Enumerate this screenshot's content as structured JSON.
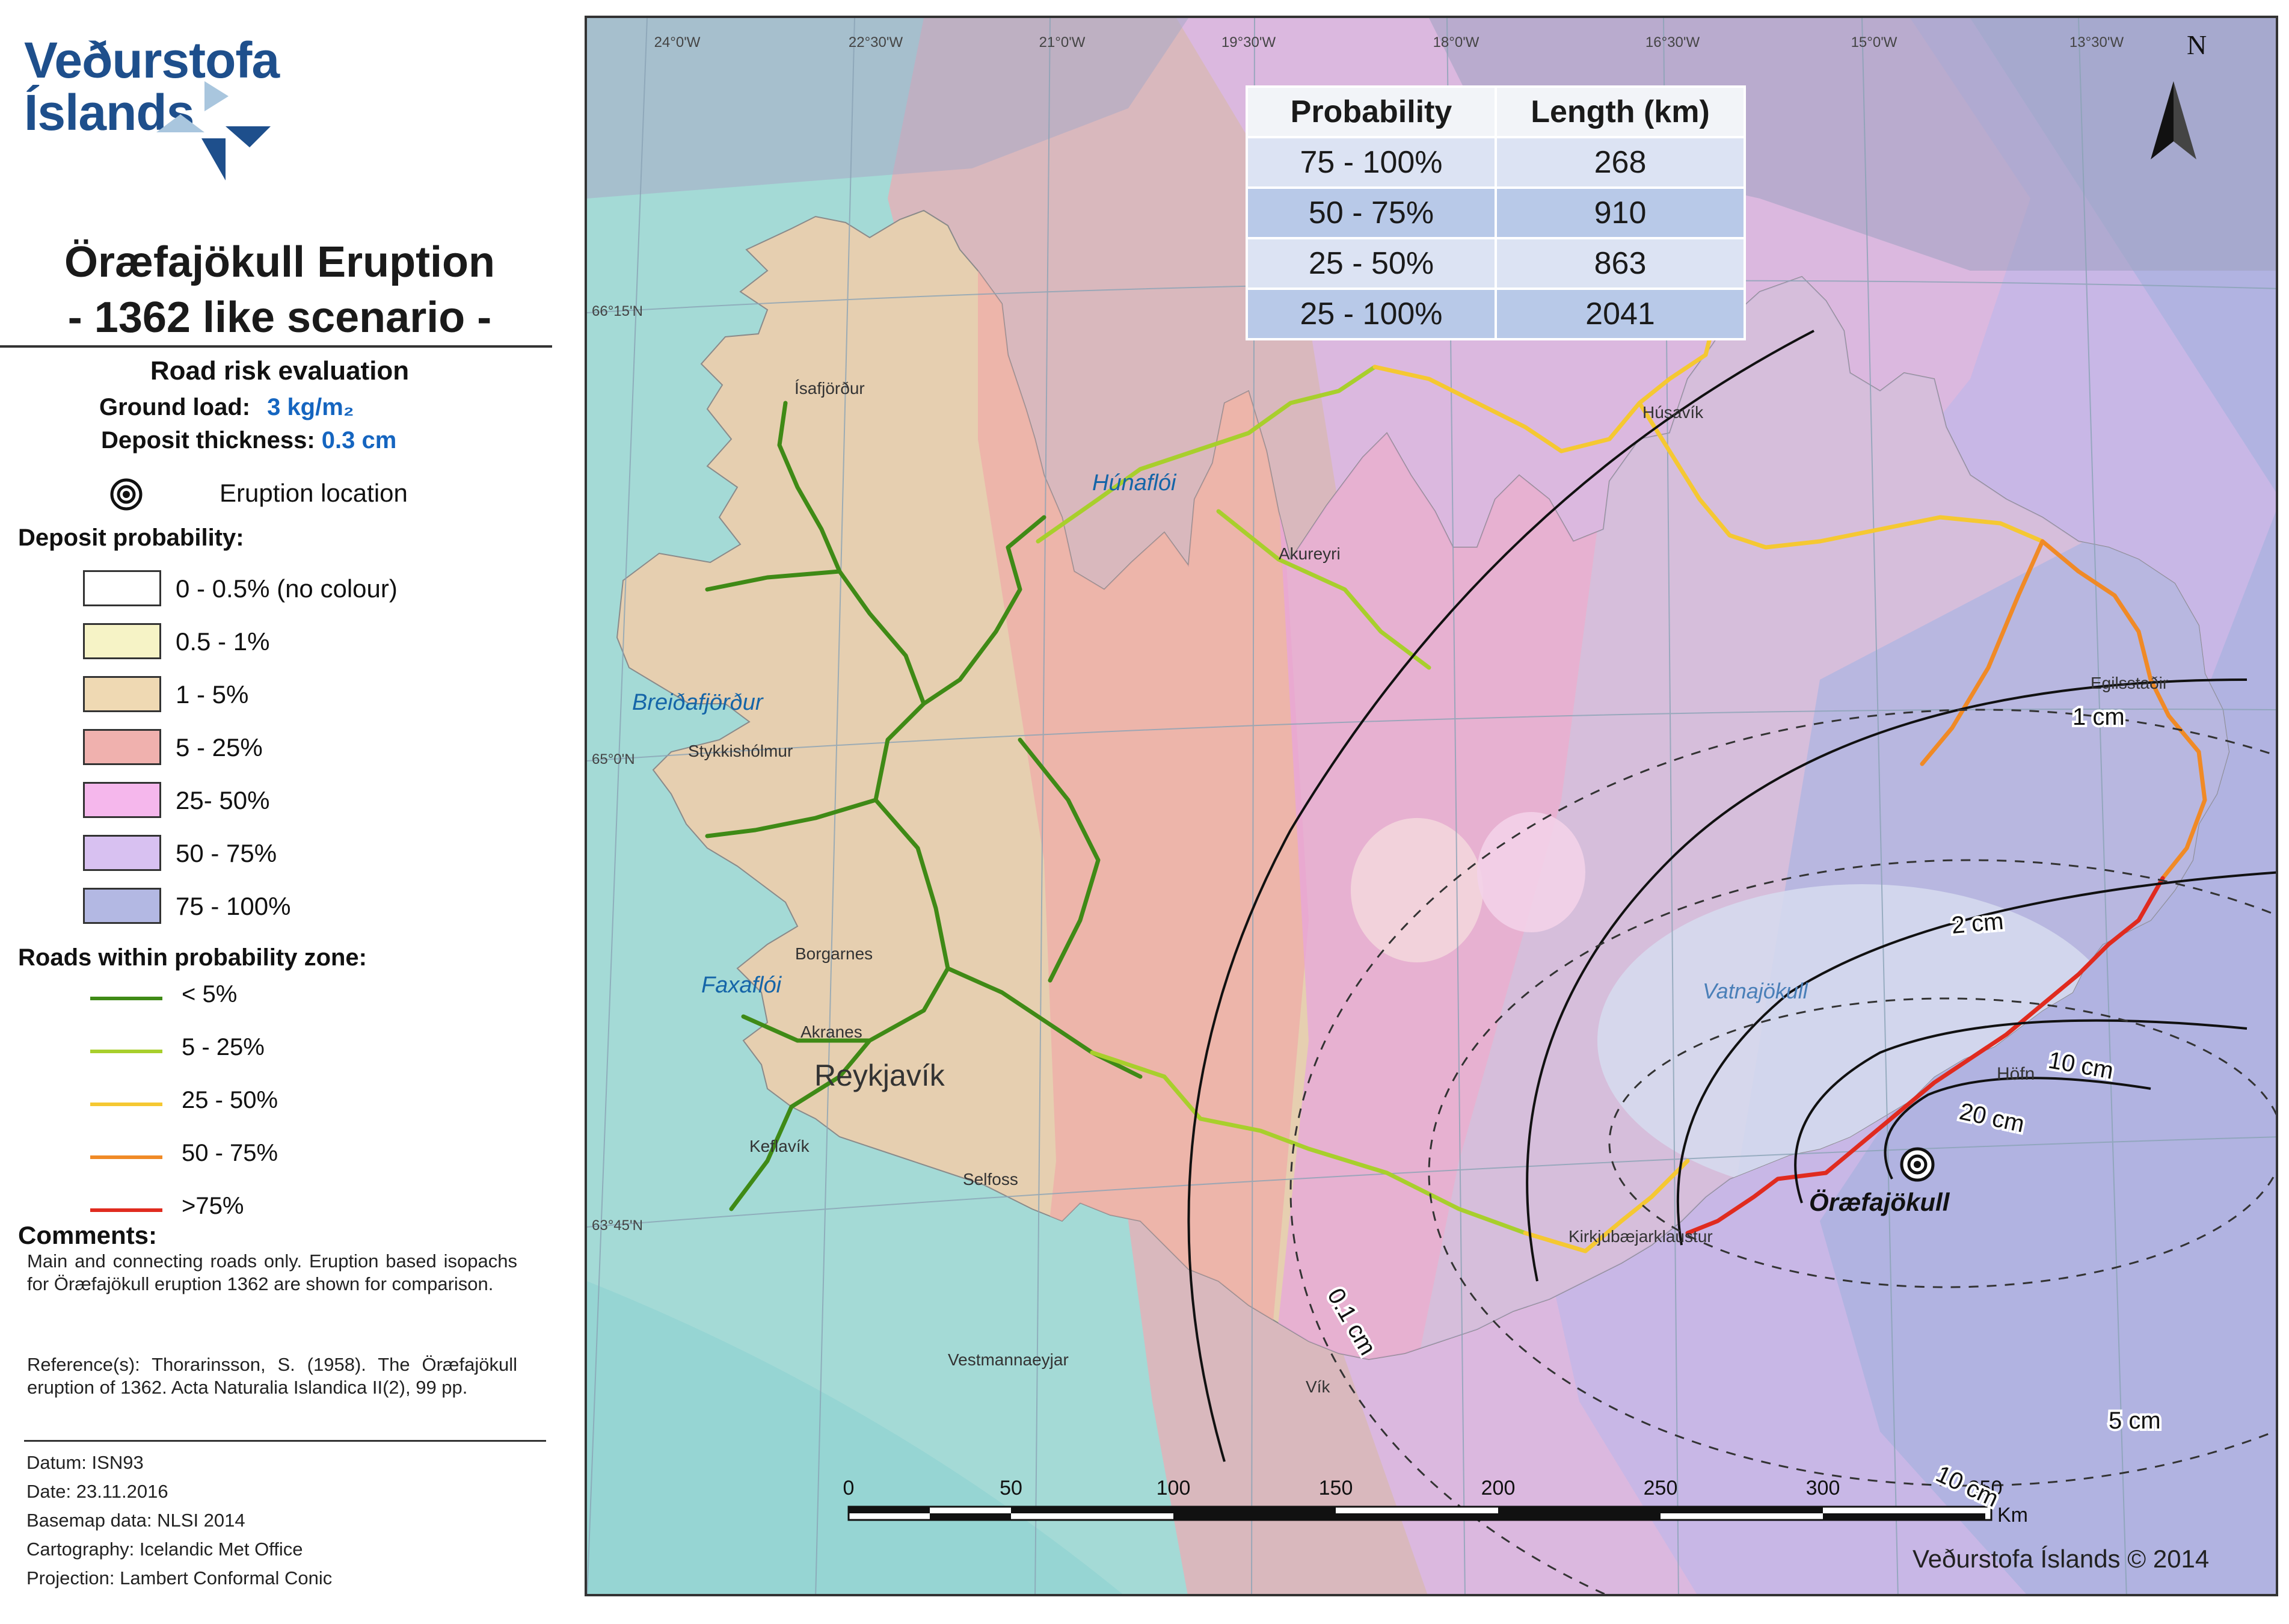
{
  "organization": {
    "line1": "Veðurstofa",
    "line2": "Íslands"
  },
  "title": {
    "line1": "Öræfajökull Eruption",
    "line2": "- 1362 like scenario -"
  },
  "legend": {
    "heading": "Road risk evaluation",
    "ground_load_label": "Ground load:",
    "ground_load_value": "3 kg/m₂",
    "deposit_thickness_label": "Deposit thickness:",
    "deposit_thickness_value": "0.3 cm",
    "eruption_location_label": "Eruption location",
    "deposit_probability_heading": "Deposit probability:",
    "deposit_classes": [
      {
        "label": "0 - 0.5% (no colour)",
        "color": "#ffffff"
      },
      {
        "label": "0.5 - 1%",
        "color": "#f6f3c6"
      },
      {
        "label": "1 - 5%",
        "color": "#efd9b3"
      },
      {
        "label": "5 - 25%",
        "color": "#f0b1ae"
      },
      {
        "label": "25- 50%",
        "color": "#f5b7ec"
      },
      {
        "label": "50 - 75%",
        "color": "#d8c1f1"
      },
      {
        "label": "75 - 100%",
        "color": "#b3b8e3"
      }
    ],
    "roads_heading": "Roads within probability zone:",
    "road_classes": [
      {
        "label": "< 5%",
        "color": "#3f8a16"
      },
      {
        "label": "5 - 25%",
        "color": "#a8cf2c"
      },
      {
        "label": "25 - 50%",
        "color": "#f5c832"
      },
      {
        "label": "50 - 75%",
        "color": "#f08a26"
      },
      {
        "label": ">75%",
        "color": "#e02b1f"
      }
    ]
  },
  "comments": {
    "heading": "Comments:",
    "text": "Main and connecting roads only. Eruption based isopachs for Öræfajökull eruption 1362 are shown for comparison.",
    "reference": "Reference(s): Thorarinsson, S. (1958). The Öræfajökull eruption of 1362. Acta Naturalia Islandica II(2), 99 pp."
  },
  "metadata": {
    "datum": "Datum: ISN93",
    "date": "Date: 23.11.2016",
    "basemap": "Basemap data: NLSI 2014",
    "cartography": "Cartography: Icelandic Met Office",
    "projection": "Projection: Lambert Conformal Conic"
  },
  "table": {
    "headers": [
      "Probability",
      "Length (km)"
    ],
    "rows": [
      [
        "75 - 100%",
        "268"
      ],
      [
        "50 - 75%",
        "910"
      ],
      [
        "25 - 50%",
        "863"
      ],
      [
        "25 - 100%",
        "2041"
      ]
    ]
  },
  "map": {
    "graticule_labels": {
      "longitudes": [
        "24°0'W",
        "22°30'W",
        "21°0'W",
        "19°30'W",
        "18°0'W",
        "16°30'W",
        "15°0'W",
        "13°30'W"
      ],
      "latitudes": [
        "66°15'N",
        "65°0'N",
        "63°45'N"
      ]
    },
    "north_label": "N",
    "place_names": [
      {
        "name": "Húnaflói",
        "kind": "water"
      },
      {
        "name": "Breiðafjörður",
        "kind": "water"
      },
      {
        "name": "Faxaflói",
        "kind": "water"
      },
      {
        "name": "Vatnajökull",
        "kind": "water"
      },
      {
        "name": "Reykjavík",
        "kind": "city"
      },
      {
        "name": "Öræfajökull",
        "kind": "volcano"
      },
      {
        "name": "Ísafjörður",
        "kind": "town"
      },
      {
        "name": "Stykkishólmur",
        "kind": "town"
      },
      {
        "name": "Borgarnes",
        "kind": "town"
      },
      {
        "name": "Akranes",
        "kind": "town"
      },
      {
        "name": "Keflavík",
        "kind": "town"
      },
      {
        "name": "Selfoss",
        "kind": "town"
      },
      {
        "name": "Akureyri",
        "kind": "town"
      },
      {
        "name": "Húsavík",
        "kind": "town"
      },
      {
        "name": "Egilsstaðir",
        "kind": "town"
      },
      {
        "name": "Höfn",
        "kind": "town"
      },
      {
        "name": "Kirkjubæjarklaustur",
        "kind": "town"
      },
      {
        "name": "Vík",
        "kind": "town"
      },
      {
        "name": "Vestmannaeyjar",
        "kind": "town"
      }
    ],
    "isopachs": [
      "0.1 cm",
      "1 cm",
      "2 cm",
      "10 cm",
      "20 cm",
      "5 cm",
      "10 cm"
    ],
    "scale_bar": {
      "ticks": [
        "0",
        "50",
        "100",
        "150",
        "200",
        "250",
        "300",
        "350"
      ],
      "unit": "Km"
    },
    "copyright": "Veðurstofa Íslands © 2014"
  }
}
